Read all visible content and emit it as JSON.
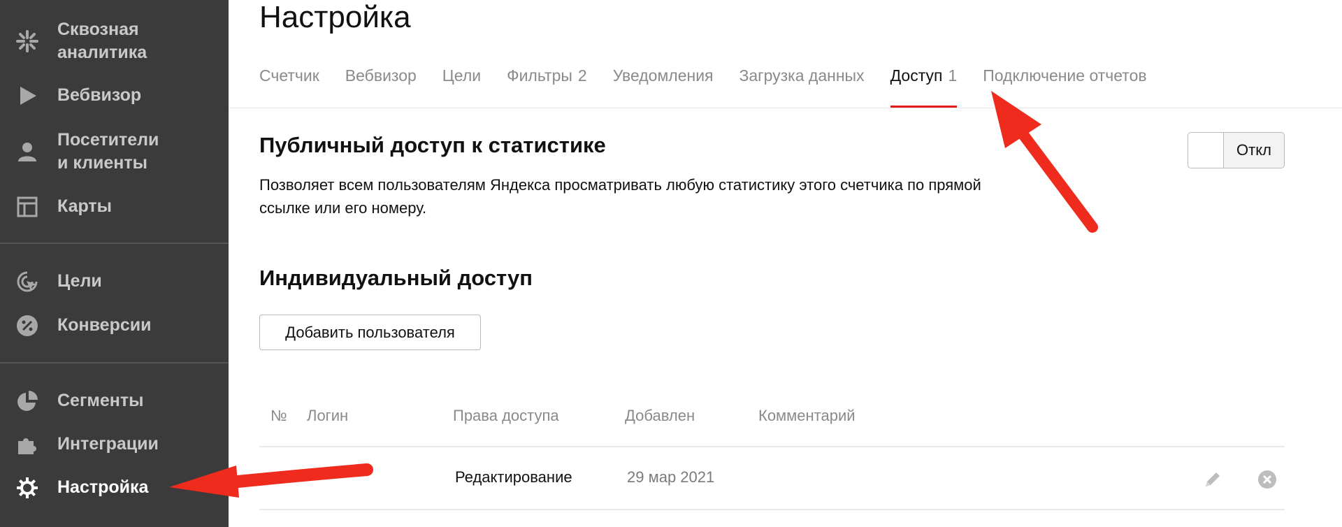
{
  "sidebar": {
    "items": [
      {
        "label": "Сквозная\nаналитика",
        "icon": "end-to-end-analytics-icon"
      },
      {
        "label": "Вебвизор",
        "icon": "play-icon"
      },
      {
        "label": "Посетители\nи клиенты",
        "icon": "person-icon"
      },
      {
        "label": "Карты",
        "icon": "map-layout-icon"
      },
      {
        "label": "Цели",
        "icon": "target-cursor-icon"
      },
      {
        "label": "Конверсии",
        "icon": "percent-icon"
      },
      {
        "label": "Сегменты",
        "icon": "pie-chart-icon"
      },
      {
        "label": "Интеграции",
        "icon": "puzzle-icon"
      },
      {
        "label": "Настройка",
        "icon": "gear-icon",
        "active": true
      }
    ]
  },
  "page": {
    "title": "Настройка"
  },
  "tabs": [
    {
      "label": "Счетчик",
      "count": ""
    },
    {
      "label": "Вебвизор",
      "count": ""
    },
    {
      "label": "Цели",
      "count": ""
    },
    {
      "label": "Фильтры",
      "count": "2"
    },
    {
      "label": "Уведомления",
      "count": ""
    },
    {
      "label": "Загрузка данных",
      "count": ""
    },
    {
      "label": "Доступ",
      "count": "1",
      "active": true
    },
    {
      "label": "Подключение отчетов",
      "count": ""
    }
  ],
  "public_access": {
    "title": "Публичный доступ к статистике",
    "description": "Позволяет всем пользователям Яндекса просматривать любую статистику этого счетчика по прямой ссылке или его номеру.",
    "toggle_state": "Откл"
  },
  "individual_access": {
    "title": "Индивидуальный доступ",
    "add_button": "Добавить пользователя",
    "columns": {
      "num": "№",
      "login": "Логин",
      "rights": "Права доступа",
      "added": "Добавлен",
      "comment": "Комментарий"
    },
    "rows": [
      {
        "rights": "Редактирование",
        "added": "29 мар 2021"
      }
    ]
  },
  "colors": {
    "sidebar_bg": "#3b3b3b",
    "accent_red": "#e21a1a",
    "arrow_red": "#ee2b1c"
  }
}
